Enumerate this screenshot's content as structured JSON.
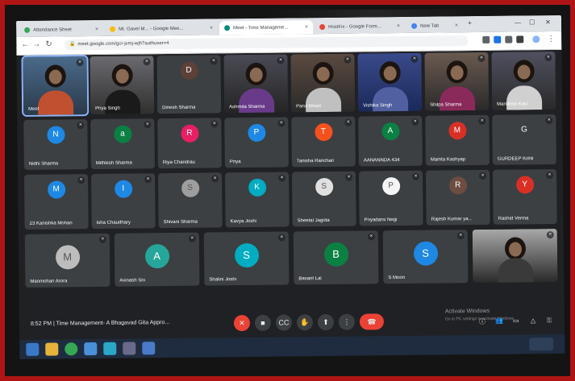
{
  "browser": {
    "tabs": [
      {
        "label": "Attendance Sheet",
        "active": false,
        "favicon_color": "#34a853"
      },
      {
        "label": "Mr. Gavel M... - Google Mee...",
        "active": false,
        "favicon_color": "#fbbc04"
      },
      {
        "label": "Meet - Time Manageme...",
        "active": true,
        "favicon_color": "#00897b"
      },
      {
        "label": "HostFix - Google Form...",
        "active": false,
        "favicon_color": "#ea4335"
      },
      {
        "label": "New Tab",
        "active": false,
        "favicon_color": "#4285f4"
      }
    ],
    "url": "meet.google.com/gcr-jvmj-wjh?authuser=4"
  },
  "participants": [
    {
      "name": "Meet",
      "type": "video",
      "self": true,
      "colors": [
        "#4a6a8a",
        "#2a3a4a",
        "#c05030"
      ]
    },
    {
      "name": "Priya Singh",
      "type": "video",
      "colors": [
        "#6a6a70",
        "#30302f",
        "#1a1a1a"
      ]
    },
    {
      "name": "Dinesh Sharma",
      "type": "avatar",
      "initial": "D",
      "color": "#5d4037"
    },
    {
      "name": "Ashmita Sharma",
      "type": "video",
      "colors": [
        "#4a4a55",
        "#252525",
        "#6a3a8a"
      ]
    },
    {
      "name": "Parul Moad",
      "type": "video",
      "colors": [
        "#5a4a40",
        "#2a2a2a",
        "#c0c0c0"
      ]
    },
    {
      "name": "Vishika Singh",
      "type": "video",
      "colors": [
        "#3a4a8a",
        "#1a2a5a",
        "#5060a0"
      ]
    },
    {
      "name": "Shilpa Sharma",
      "type": "video",
      "colors": [
        "#6a5a50",
        "#2a2a2a",
        "#8a2a5a"
      ]
    },
    {
      "name": "Mandeep Kaur",
      "type": "video",
      "colors": [
        "#505060",
        "#2a2a2a",
        "#d0d0d0"
      ]
    },
    {
      "name": "Nidhi Sharma",
      "type": "avatar",
      "initial": "N",
      "color": "#1e88e5"
    },
    {
      "name": "Mithlesh Sharma",
      "type": "avatar",
      "initial": "a",
      "color": "#0b8043"
    },
    {
      "name": "Riya Chandrau",
      "type": "avatar",
      "initial": "R",
      "color": "#e91e63"
    },
    {
      "name": "Priya",
      "type": "avatar",
      "initial": "P",
      "color": "#1e88e5"
    },
    {
      "name": "Tanisha Ranchan",
      "type": "avatar",
      "initial": "T",
      "color": "#f4511e"
    },
    {
      "name": "AANANNDA 434",
      "type": "avatar",
      "initial": "A",
      "color": "#0b8043"
    },
    {
      "name": "Mamta Kashyap",
      "type": "avatar",
      "initial": "M",
      "color": "#d93025"
    },
    {
      "name": "GURDEEP Kohli",
      "type": "avatar",
      "initial": "G",
      "color": "#3c4043"
    },
    {
      "name": "23 Kanishka Mohan",
      "type": "avatar",
      "initial": "M",
      "color": "#1e88e5"
    },
    {
      "name": "Isha Chaudhary",
      "type": "avatar",
      "initial": "I",
      "color": "#1e88e5"
    },
    {
      "name": "Shivani Sharma",
      "type": "photo",
      "initial": "S",
      "color": "#9e9e9e"
    },
    {
      "name": "Kavya Joshi",
      "type": "avatar",
      "initial": "K",
      "color": "#00acc1"
    },
    {
      "name": "Sheetal Jagota",
      "type": "photo",
      "initial": "S",
      "color": "#e0e0e0"
    },
    {
      "name": "Priyadarsi Negi",
      "type": "photo",
      "initial": "P",
      "color": "#f5f5f5"
    },
    {
      "name": "Rajesh Kumar ya...",
      "type": "avatar",
      "initial": "R",
      "color": "#6d4c41"
    },
    {
      "name": "Rashid Verma",
      "type": "avatar",
      "initial": "Y",
      "color": "#d93025"
    },
    {
      "name": "Manmohan Arora",
      "type": "photo",
      "initial": "M",
      "color": "#bdbdbd"
    },
    {
      "name": "Avinash Soi",
      "type": "avatar",
      "initial": "A",
      "color": "#26a69a"
    },
    {
      "name": "Shalini Joshi",
      "type": "avatar",
      "initial": "S",
      "color": "#00acc1"
    },
    {
      "name": "Basant Lal",
      "type": "avatar",
      "initial": "B",
      "color": "#0b8043"
    },
    {
      "name": "S Moon",
      "type": "avatar",
      "initial": "S",
      "color": "#1e88e5"
    },
    {
      "name": "",
      "type": "video",
      "colors": [
        "#a8a8a8",
        "#2a2a2a",
        "#3a3a3a"
      ]
    }
  ],
  "meeting": {
    "time": "8:52 PM",
    "title": "Time Management- A Bhagavad Gita Appro..."
  },
  "controls": [
    {
      "icon": "mic-off-icon",
      "glyph": "✕",
      "danger": true
    },
    {
      "icon": "camera-icon",
      "glyph": "■",
      "danger": false
    },
    {
      "icon": "captions-icon",
      "glyph": "CC",
      "danger": false
    },
    {
      "icon": "raise-hand-icon",
      "glyph": "✋",
      "danger": false
    },
    {
      "icon": "present-icon",
      "glyph": "⬆",
      "danger": false
    },
    {
      "icon": "more-options-icon",
      "glyph": "⋮",
      "danger": false
    },
    {
      "icon": "end-call-icon",
      "glyph": "☎",
      "danger": true
    }
  ],
  "watermark": {
    "line1": "Activate Windows",
    "line2": "Go to PC settings to activate Windows."
  }
}
